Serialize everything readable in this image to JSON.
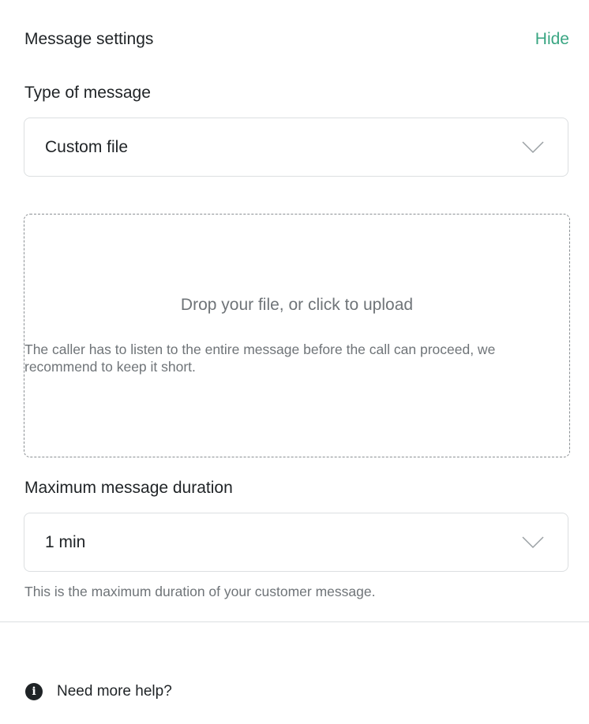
{
  "header": {
    "title": "Message settings",
    "hide_label": "Hide"
  },
  "message_type": {
    "label": "Type of message",
    "value": "Custom file",
    "icon": "chevron-down-icon"
  },
  "upload": {
    "title": "Drop your file, or click to upload",
    "hint": "The caller has to listen to the entire message before the call can proceed, we recommend to keep it short."
  },
  "duration": {
    "label": "Maximum message duration",
    "value": "1 min",
    "icon": "chevron-down-icon",
    "help_text": "This is the maximum duration of your customer message."
  },
  "footer": {
    "help_label": "Need more help?",
    "help_icon_glyph": "i",
    "help_icon": "info-icon"
  },
  "colors": {
    "accent": "#3aa683",
    "text": "#1f2326",
    "muted": "#6f7478",
    "border": "#dcdfe1"
  }
}
